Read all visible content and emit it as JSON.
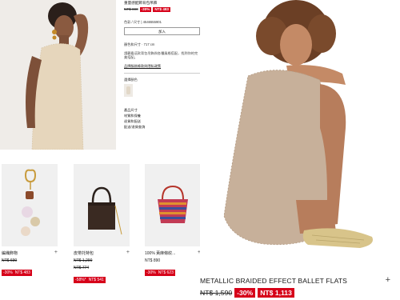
{
  "details": {
    "title": "重量感配飾背包吊飾",
    "price_original": "NT$ 690",
    "discount": "-30%",
    "price_sale": "NT$ 483",
    "color_label": "色彩 / 尺寸 | 4546555901",
    "add_button": "加入",
    "spacer_text": "顏色和尺寸 · 717 cm",
    "paragraph": "請觀看這款背包吊飾與各種風格搭配，找到你的完美搭配。",
    "link_text": "品牌服務條款與隱私政策",
    "swatch_label": "選擇顏色",
    "meta": [
      "產品尺寸",
      "材質和保養",
      "退貨和配送",
      "配送/退貨查詢"
    ]
  },
  "grid": [
    {
      "name": "編織飾物",
      "orig": "NT$ 690",
      "discount": "-30%",
      "sale": "NT$ 483"
    },
    {
      "name": "皮帶托特包",
      "orig": "NT$ 1,290",
      "orig2": "NT$ 774",
      "discount": "-58%*",
      "sale": "NT$ 541"
    },
    {
      "name": "100% 黃麻條紋...",
      "orig": "NT$ 890",
      "discount": "-30%",
      "sale": "NT$ 623"
    }
  ],
  "right": {
    "name": "METALLIC BRAIDED EFFECT BALLET FLATS",
    "orig": "NT$ 1,590",
    "discount": "-30%",
    "sale": "NT$ 1,113"
  },
  "icons": {
    "plus": "+"
  },
  "colors": {
    "sale_red": "#d60019"
  }
}
